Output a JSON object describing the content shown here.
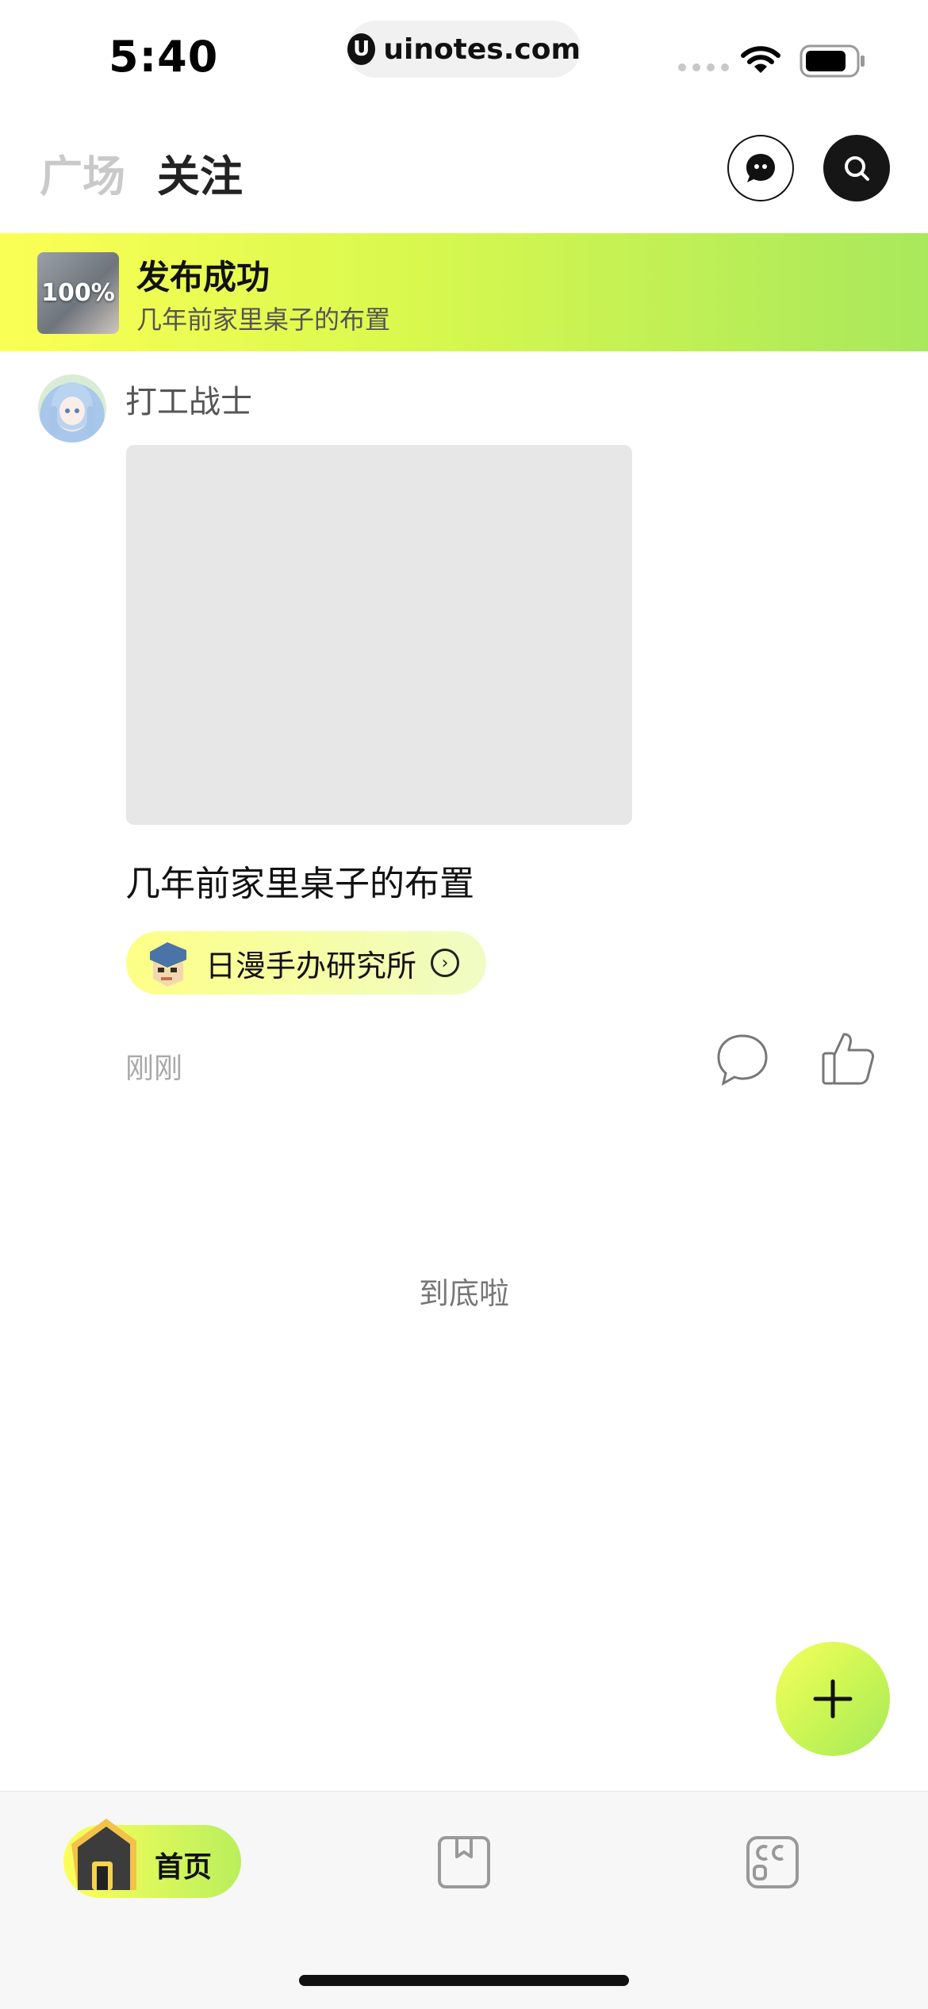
{
  "status_bar": {
    "time": "5:40",
    "url_logo": "U",
    "url": "uinotes.com",
    "icons": [
      "signal-dots-icon",
      "wifi-icon",
      "battery-icon"
    ]
  },
  "top_nav": {
    "tabs": [
      {
        "label": "广场",
        "active": false
      },
      {
        "label": "关注",
        "active": true
      }
    ],
    "icons": [
      "message-icon",
      "search-icon"
    ]
  },
  "publish_banner": {
    "progress_label": "100%",
    "progress": 1.0,
    "title": "发布成功",
    "subtitle": "几年前家里桌子的布置"
  },
  "post": {
    "username": "打工战士",
    "title": "几年前家里桌子的布置",
    "circle_name": "日漫手办研究所",
    "time": "刚刚",
    "icons": [
      "comment-icon",
      "like-icon"
    ]
  },
  "feed_end_text": "到底啦",
  "fab_icon": "plus-icon",
  "bottom_nav": {
    "items": [
      {
        "label": "首页",
        "icon": "home-icon",
        "active": true
      },
      {
        "label": "",
        "icon": "book-icon",
        "active": false
      },
      {
        "label": "",
        "icon": "cc-icon",
        "active": false
      }
    ]
  },
  "colors": {
    "accent_yellow": "#fbff55",
    "accent_green": "#a9e85c",
    "text_primary": "#111111",
    "text_muted": "#a8a8a8"
  }
}
